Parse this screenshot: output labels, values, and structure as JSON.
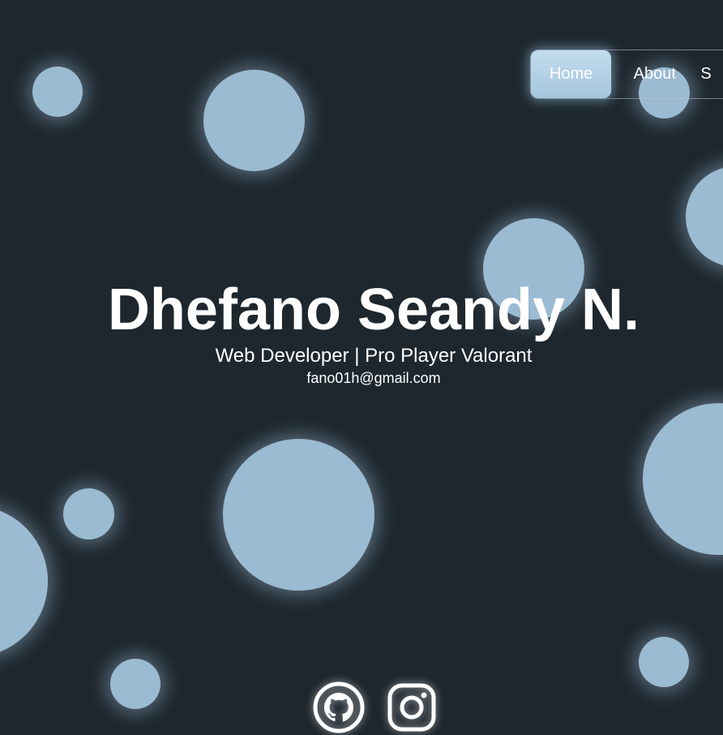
{
  "nav": {
    "items": [
      {
        "label": "Home",
        "active": true
      },
      {
        "label": "About",
        "active": false
      },
      {
        "label": "S",
        "active": false
      }
    ]
  },
  "hero": {
    "name": "Dhefano Seandy N.",
    "tagline": "Web Developer | Pro Player Valorant",
    "email": "fano01h@gmail.com"
  },
  "socials": [
    {
      "icon": "github-icon"
    },
    {
      "icon": "instagram-icon"
    }
  ],
  "colors": {
    "background": "#1e272e",
    "bubble": "#9bbbd2",
    "nav_active": "#a4c6de",
    "text": "#ffffff"
  }
}
